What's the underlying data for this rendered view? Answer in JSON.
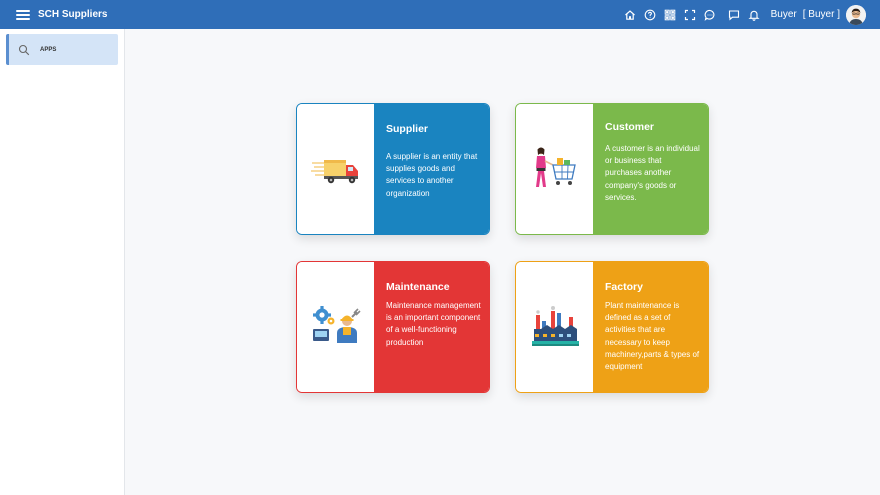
{
  "header": {
    "title": "SCH Suppliers",
    "user_name": "Buyer",
    "user_role": "[ Buyer ]"
  },
  "header_icons": [
    "home-icon",
    "help-icon",
    "qr-code-icon",
    "fullscreen-icon",
    "chat-icon",
    "message-icon",
    "bell-icon"
  ],
  "sidebar": {
    "items": [
      {
        "label": "APPS",
        "icon": "search-icon"
      }
    ]
  },
  "cards": [
    {
      "title": "Supplier",
      "description": "A supplier is an entity that supplies goods and services to another organization",
      "color": "#1a84c0",
      "border": "#1a84c0",
      "icon": "delivery-truck-icon"
    },
    {
      "title": "Customer",
      "description": "A customer is an individual or business that purchases another company's goods or services.",
      "color": "#7bb94b",
      "border": "#7bb94b",
      "icon": "shopping-cart-icon"
    },
    {
      "title": "Maintenance",
      "description": "Maintenance management is an important component of a well-functioning production",
      "color": "#e33636",
      "border": "#e33636",
      "icon": "maintenance-worker-icon"
    },
    {
      "title": "Factory",
      "description": "Plant maintenance is defined as a set of activities that are necessary to keep machinery,parts & types of equipment",
      "color": "#eea116",
      "border": "#eea116",
      "icon": "factory-icon"
    }
  ]
}
